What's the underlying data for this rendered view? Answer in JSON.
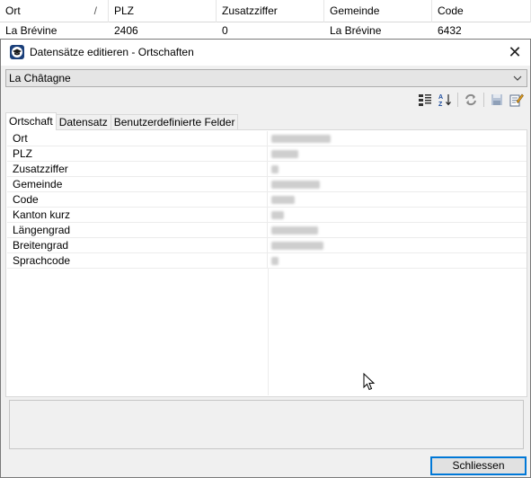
{
  "grid": {
    "columns": [
      "Ort",
      "PLZ",
      "Zusatzziffer",
      "Gemeinde",
      "Code"
    ],
    "sort_indicator": "/",
    "row": [
      "La Brévine",
      "2406",
      "0",
      "La Brévine",
      "6432"
    ]
  },
  "dialog": {
    "title": "Datensätze editieren - Ortschaften",
    "close_glyph": "✕",
    "record_select": "La Châtagne",
    "tabs": [
      "Ortschaft",
      "Datensatz",
      "Benutzerdefinierte Felder"
    ],
    "properties": [
      {
        "name": "Ort"
      },
      {
        "name": "PLZ"
      },
      {
        "name": "Zusatzziffer"
      },
      {
        "name": "Gemeinde"
      },
      {
        "name": "Code"
      },
      {
        "name": "Kanton kurz"
      },
      {
        "name": "Längengrad"
      },
      {
        "name": "Breitengrad"
      },
      {
        "name": "Sprachcode"
      }
    ],
    "close_button": "Schliessen"
  },
  "icons": {
    "toolbar": [
      "categorized-view-icon",
      "sort-alpha-icon",
      "refresh-icon",
      "save-icon",
      "edit-icon"
    ],
    "accent": "#0078d7"
  }
}
